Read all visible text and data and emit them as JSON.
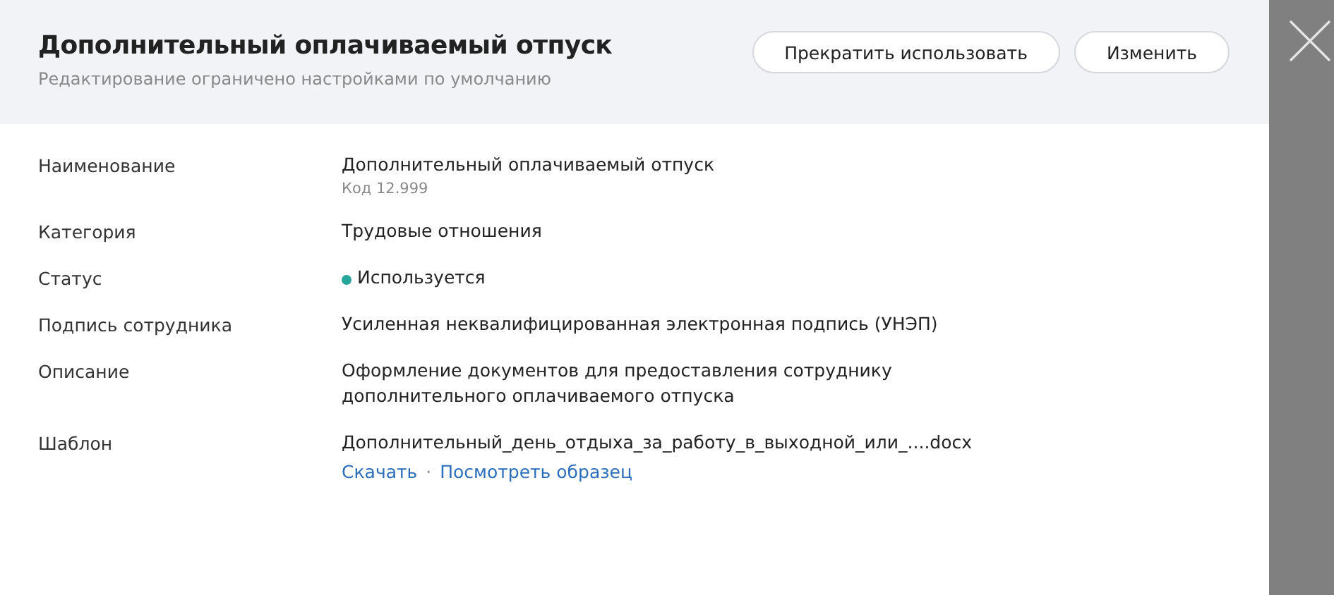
{
  "header": {
    "title": "Дополнительный оплачиваемый отпуск",
    "subtitle": "Редактирование ограничено настройками по умолчанию",
    "buttons": [
      "Прекратить использовать",
      "Изменить"
    ]
  },
  "fields": [
    {
      "kind": "text",
      "label": "Наименование",
      "value": "Дополнительный оплачиваемый отпуск",
      "note": "Код 12.999"
    },
    {
      "kind": "text",
      "label": "Категория",
      "value": "Трудовые отношения"
    },
    {
      "kind": "status",
      "label": "Статус",
      "value": "Используется",
      "color": "#26a69a"
    },
    {
      "kind": "text",
      "label": "Подпись сотрудника",
      "value": "Усиленная неквалифицированная электронная подпись (УНЭП)"
    },
    {
      "kind": "text",
      "label": "Описание",
      "value": "Оформление документов для предоставления сотруднику дополнительного оплачиваемого отпуска"
    },
    {
      "kind": "file",
      "label": "Шаблон",
      "value": "Дополнительный_день_отдыха_за_работу_в_выходной_или_....docx",
      "links": [
        "Скачать",
        "Посмотреть образец"
      ],
      "separator": "·"
    }
  ]
}
